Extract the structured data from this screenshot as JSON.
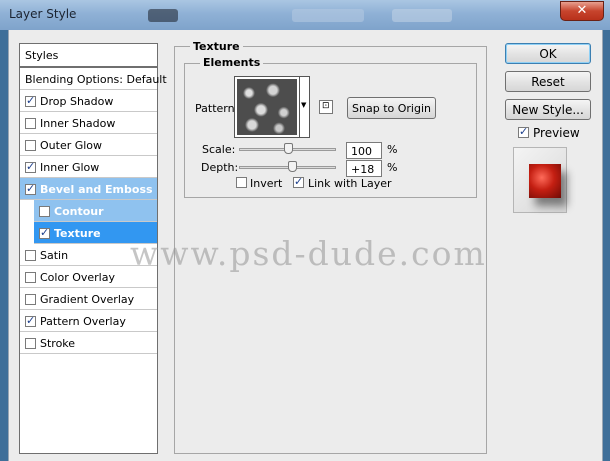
{
  "window": {
    "title": "Layer Style",
    "close_glyph": "✕"
  },
  "styles_header": "Styles",
  "style_list": [
    {
      "label": "Blending Options: Default",
      "checkbox": false,
      "checked": false,
      "state": "normal",
      "indent": false
    },
    {
      "label": "Drop Shadow",
      "checkbox": true,
      "checked": true,
      "state": "normal",
      "indent": false
    },
    {
      "label": "Inner Shadow",
      "checkbox": true,
      "checked": false,
      "state": "normal",
      "indent": false
    },
    {
      "label": "Outer Glow",
      "checkbox": true,
      "checked": false,
      "state": "normal",
      "indent": false
    },
    {
      "label": "Inner Glow",
      "checkbox": true,
      "checked": true,
      "state": "normal",
      "indent": false
    },
    {
      "label": "Bevel and Emboss",
      "checkbox": true,
      "checked": true,
      "state": "selected-light",
      "indent": false
    },
    {
      "label": "Contour",
      "checkbox": true,
      "checked": false,
      "state": "selected-light",
      "indent": true
    },
    {
      "label": "Texture",
      "checkbox": true,
      "checked": true,
      "state": "selected",
      "indent": true
    },
    {
      "label": "Satin",
      "checkbox": true,
      "checked": false,
      "state": "normal",
      "indent": false
    },
    {
      "label": "Color Overlay",
      "checkbox": true,
      "checked": false,
      "state": "normal",
      "indent": false
    },
    {
      "label": "Gradient Overlay",
      "checkbox": true,
      "checked": false,
      "state": "normal",
      "indent": false
    },
    {
      "label": "Pattern Overlay",
      "checkbox": true,
      "checked": true,
      "state": "normal",
      "indent": false
    },
    {
      "label": "Stroke",
      "checkbox": true,
      "checked": false,
      "state": "normal",
      "indent": false
    }
  ],
  "texture": {
    "group_title": "Texture",
    "elements_title": "Elements",
    "pattern_label": "Pattern:",
    "snap_button": "Snap to Origin",
    "scale_label": "Scale:",
    "scale_value": "100",
    "scale_unit": "%",
    "scale_fraction": 0.5,
    "depth_label": "Depth:",
    "depth_value": "+18",
    "depth_unit": "%",
    "depth_fraction": 0.55,
    "invert_label": "Invert",
    "invert_checked": false,
    "link_label": "Link with Layer",
    "link_checked": true
  },
  "buttons": {
    "ok": "OK",
    "reset": "Reset",
    "new_style": "New Style..."
  },
  "preview": {
    "label": "Preview",
    "checked": true
  },
  "watermark": "www.psd-dude.com",
  "colors": {
    "selected": "#3297f1",
    "selected_light": "#8fc2ef",
    "titlebar": "#8fb1d6",
    "close": "#c7442d",
    "dialog": "#ececec"
  }
}
